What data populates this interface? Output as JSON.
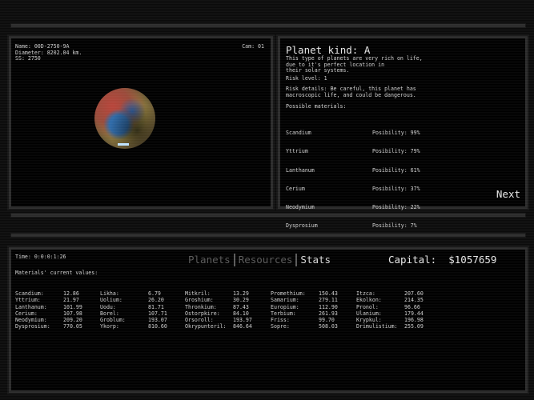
{
  "camera": {
    "info_lines": "Name: 00D-2750-9A\nDiameter: 8202.04 km.\nSS: 2750",
    "cam_label": "Cam: 01"
  },
  "planet": {
    "title": "Planet kind: A",
    "description": "This type of planets are very rich on life,\ndue to it's perfect location in\ntheir solar systems.",
    "risk_level": "Risk level: 1",
    "risk_details": "Risk details: Be careful, this planet has\nmacroscopic life, and could be dangerous.",
    "possible_title": "Possible materials:",
    "materials": [
      {
        "name": "Scandium",
        "possibility": "Posibility: 99%"
      },
      {
        "name": "Yttrium",
        "possibility": "Posibility: 79%"
      },
      {
        "name": "Lanthanum",
        "possibility": "Posibility: 61%"
      },
      {
        "name": "Cerium",
        "possibility": "Posibility: 37%"
      },
      {
        "name": "Neodymium",
        "possibility": "Posibility: 22%"
      },
      {
        "name": "Dysprosium",
        "possibility": "Posibility: 7%"
      }
    ],
    "next_label": "Next"
  },
  "bottom": {
    "time": "Time: 0:0:0:1:26",
    "tabs": [
      {
        "label": "Planets",
        "active": false
      },
      {
        "label": "Resources",
        "active": false
      },
      {
        "label": "Stats",
        "active": true
      }
    ],
    "capital": "Capital:  $1057659",
    "current_title": "Materials' current values:",
    "columns": [
      [
        {
          "name": "Scandium:",
          "value": "12.86"
        },
        {
          "name": "Yttrium:",
          "value": "21.97"
        },
        {
          "name": "Lanthanum:",
          "value": "101.99"
        },
        {
          "name": "Cerium:",
          "value": "107.98"
        },
        {
          "name": "Neodymium:",
          "value": "209.20"
        },
        {
          "name": "Dysprosium:",
          "value": "770.05"
        }
      ],
      [
        {
          "name": "Likha:",
          "value": "6.79"
        },
        {
          "name": "Uolium:",
          "value": "26.20"
        },
        {
          "name": "Uodu:",
          "value": "81.71"
        },
        {
          "name": "Borel:",
          "value": "107.71"
        },
        {
          "name": "Groblum:",
          "value": "193.07"
        },
        {
          "name": "Ykorp:",
          "value": "810.60"
        }
      ],
      [
        {
          "name": "Mitkril:",
          "value": "13.29"
        },
        {
          "name": "Groshium:",
          "value": "30.29"
        },
        {
          "name": "Thronkium:",
          "value": "87.43"
        },
        {
          "name": "Ostorpkire:",
          "value": "84.10"
        },
        {
          "name": "Orsoroll:",
          "value": "193.97"
        },
        {
          "name": "Okrypunteril:",
          "value": "846.64"
        }
      ],
      [
        {
          "name": "Promethium:",
          "value": "150.43"
        },
        {
          "name": "Samarium:",
          "value": "279.11"
        },
        {
          "name": "Europium:",
          "value": "112.90"
        },
        {
          "name": "Terbium:",
          "value": "261.93"
        },
        {
          "name": "Friss:",
          "value": "99.70"
        },
        {
          "name": "Sopre:",
          "value": "508.03"
        }
      ],
      [
        {
          "name": "Itzca:",
          "value": "207.60"
        },
        {
          "name": "Ekolkon:",
          "value": "214.35"
        },
        {
          "name": "Pronol:",
          "value": "96.66"
        },
        {
          "name": "Ulanium:",
          "value": "179.44"
        },
        {
          "name": "Krypkul:",
          "value": "196.98"
        },
        {
          "name": "Drimulistium:",
          "value": "255.09"
        }
      ]
    ]
  }
}
